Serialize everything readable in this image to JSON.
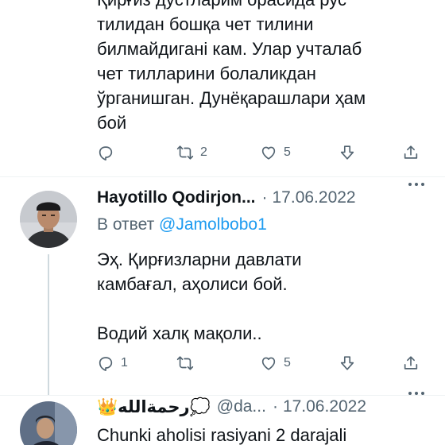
{
  "tweets": [
    {
      "text_lines": "Қирғиз дўстларим орасида рус\nтилидан бошқа чет тилини\nбилмайдиганi кам. Улар учталаб\nчет тилларини болаликдан\nўрганишган. Дунёқарашлари ҳам\nбой",
      "actions": {
        "reply": "",
        "retweet": "2",
        "like": "5"
      }
    },
    {
      "name": "Hayotillo Qodirjon...",
      "dot": "·",
      "date": "17.06.2022",
      "reply_prefix": "В ответ",
      "reply_mention": "@Jamolbobo1",
      "text_lines": "Эҳ. Қирғизларни давлати\nкамбағал, аҳолиси бой.\n\nВодий халқ мақоли..",
      "actions": {
        "reply": "1",
        "retweet": "",
        "like": "5"
      }
    },
    {
      "name": "👑رحمةالله💭",
      "handle": "@da...",
      "dot": "·",
      "date": "17.06.2022",
      "text_lines": "Chunki aholisi rasiyani 2 darajali"
    }
  ],
  "icons": {
    "reply": "reply-icon",
    "retweet": "retweet-icon",
    "like": "heart-icon",
    "downvote": "downvote-icon",
    "share": "share-icon"
  },
  "colors": {
    "accent": "#1d9bf0",
    "secondary": "#536471",
    "text": "#0f1419",
    "divider": "#eff3f4"
  }
}
